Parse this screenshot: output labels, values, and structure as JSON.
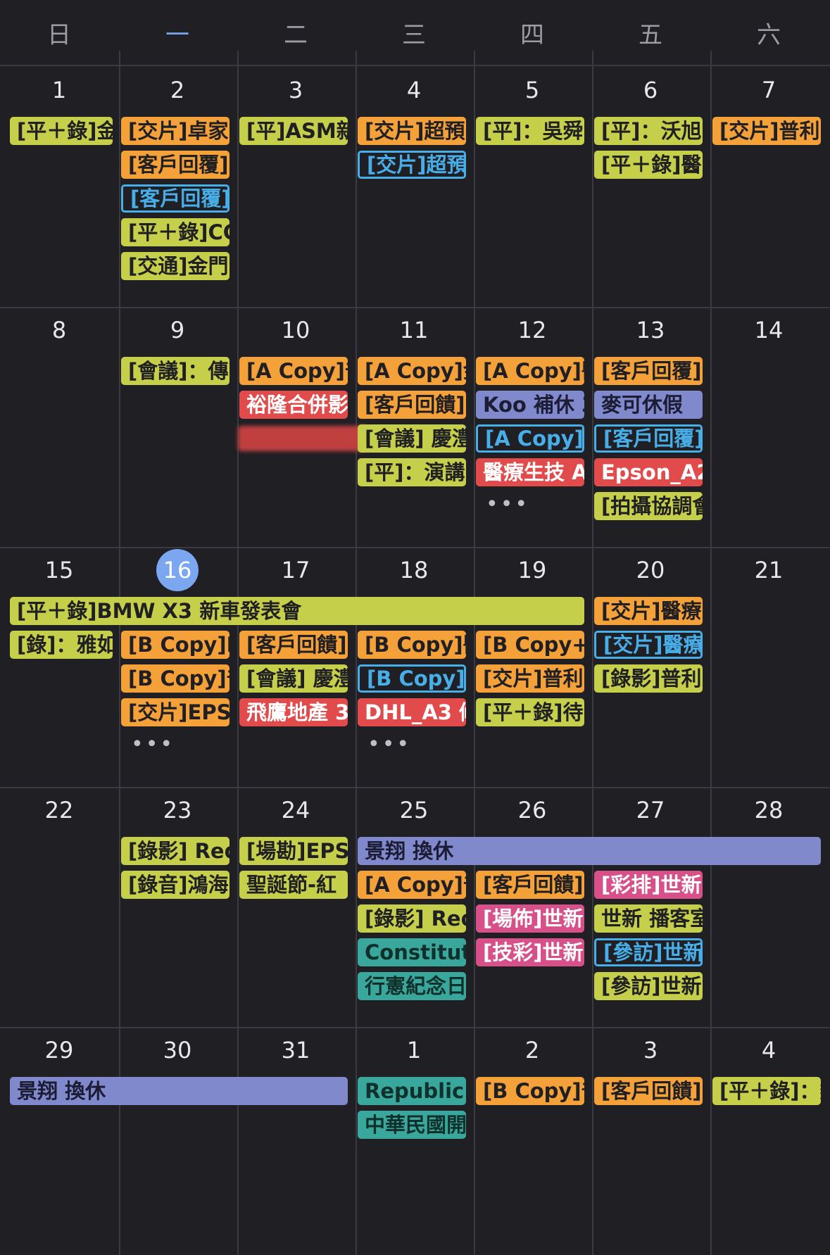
{
  "weekdays": [
    "日",
    "一",
    "二",
    "三",
    "四",
    "五",
    "六"
  ],
  "weeks": [
    {
      "dates": [
        "1",
        "2",
        "3",
        "4",
        "5",
        "6",
        "7"
      ]
    },
    {
      "dates": [
        "8",
        "9",
        "10",
        "11",
        "12",
        "13",
        "14"
      ]
    },
    {
      "dates": [
        "15",
        "16",
        "17",
        "18",
        "19",
        "20",
        "21"
      ]
    },
    {
      "dates": [
        "22",
        "23",
        "24",
        "25",
        "26",
        "27",
        "28"
      ]
    },
    {
      "dates": [
        "29",
        "30",
        "31",
        "1",
        "2",
        "3",
        "4"
      ]
    }
  ],
  "today": "16",
  "events": {
    "w1": {
      "sun1": "[平＋錄]金",
      "mon1": "[交片]卓家",
      "mon2": "[客戶回覆]",
      "mon3": "[客戶回覆]",
      "mon4": "[平＋錄]CC",
      "mon5": "[交通]金門",
      "tue1": "[平]ASM新",
      "wed1": "[交片]超預",
      "wed2": "[交片]超預",
      "thu1": "[平]：吳舜",
      "fri1": "[平]：沃旭",
      "fri2": "[平＋錄]醫",
      "sat1": "[交片]普利"
    },
    "w2": {
      "mon1": "[會議]：傳",
      "tue1": "[A Copy]普",
      "tue2": "裕隆合併影",
      "wed1": "[A Copy]金",
      "wed2": "[客戶回饋]",
      "wed3": "[會議] 慶澧",
      "wed4": "[平]：演講",
      "thu1": "[A Copy]醫",
      "thu2": "Koo 補休 3",
      "thu3": "[A Copy]醫",
      "thu4": "醫療生技 A",
      "thu_more": "•••",
      "fri1": "[客戶回覆]",
      "fri2": "麥可休假",
      "fri3": "[客戶回覆]",
      "fri4": "Epson_A2",
      "fri5": "[拍攝協調會"
    },
    "w3": {
      "span1": "[平＋錄]BMW X3 新車發表會",
      "sun1": "[錄]：雅如",
      "mon1": "[B Copy]E",
      "mon2": "[B Copy]普",
      "mon3": "[交片]EPS",
      "mon_more": "•••",
      "tue1": "[客戶回饋]",
      "tue2": "[會議] 慶澧",
      "tue3": "飛鷹地產 3",
      "wed1": "[B Copy]醫",
      "wed2": "[B Copy]醫",
      "wed3": "DHL_A3 修",
      "wed_more": "•••",
      "thu1": "[B Copy+",
      "thu2": "[交片]普利",
      "thu3": "[平＋錄]待",
      "fri1": "[交片]醫療",
      "fri2": "[交片]醫療",
      "fri3": "[錄影]普利"
    },
    "w4": {
      "span1": "景翔 換休",
      "mon1": "[錄影] Red",
      "mon2": "[錄音]鴻海",
      "tue1": "[場勘]EPS",
      "tue2": "聖誕節-紅",
      "wed1": "[A Copy]普",
      "wed2": "[錄影] Red",
      "wed3": "Constituti",
      "wed4": "行憲紀念日",
      "thu1": "[客戶回饋]",
      "thu2": "[場佈]世新",
      "thu3": "[技彩]世新",
      "fri1": "[彩排]世新",
      "fri2": "世新 播客室",
      "fri3": "[參訪]世新",
      "fri4": "[參訪]世新"
    },
    "w5": {
      "span1": "景翔 換休",
      "wed1": "Republic D",
      "wed2": "中華民國開",
      "thu1": "[B Copy]普",
      "fri1": "[客戶回饋]",
      "sat1": "[平＋錄]：類"
    }
  }
}
